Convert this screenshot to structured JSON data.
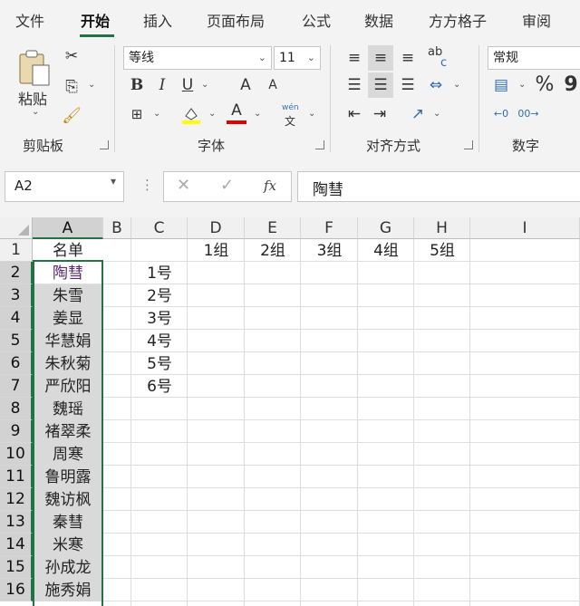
{
  "tabs": [
    "文件",
    "开始",
    "插入",
    "页面布局",
    "公式",
    "数据",
    "方方格子",
    "审阅"
  ],
  "active_tab": "开始",
  "accent_color": "#217346",
  "ribbon": {
    "clipboard": {
      "paste_label": "粘贴",
      "group_label": "剪贴板"
    },
    "font": {
      "font_name": "等线",
      "font_size": "11",
      "group_label": "字体",
      "bold": "B",
      "italic": "I",
      "underline": "U",
      "grow": "A",
      "shrink": "A",
      "font_color": "A",
      "phonetic_top": "wén",
      "phonetic_bottom": "文"
    },
    "alignment": {
      "group_label": "对齐方式",
      "wrap_top": "ab",
      "wrap_bottom": "c"
    },
    "number": {
      "format": "常规",
      "group_label": "数字",
      "percent": "%",
      "comma": "9"
    }
  },
  "formula_bar": {
    "name_box": "A2",
    "fx": "fx",
    "content": "陶彗"
  },
  "columns": [
    "A",
    "B",
    "C",
    "D",
    "E",
    "F",
    "G",
    "H",
    "I"
  ],
  "rows": [
    "1",
    "2",
    "3",
    "4",
    "5",
    "6",
    "7",
    "8",
    "9",
    "10",
    "11",
    "12",
    "13",
    "14",
    "15",
    "16"
  ],
  "cells": {
    "A1": "名单",
    "A": [
      "陶彗",
      "朱雪",
      "姜显",
      "华慧娟",
      "朱秋菊",
      "严欣阳",
      "魏瑶",
      "褚翠柔",
      "周寒",
      "鲁明露",
      "魏访枫",
      "秦彗",
      "米寒",
      "孙成龙",
      "施秀娟"
    ],
    "C": [
      "1号",
      "2号",
      "3号",
      "4号",
      "5号",
      "6号"
    ],
    "groups": [
      "1组",
      "2组",
      "3组",
      "4组",
      "5组"
    ]
  }
}
